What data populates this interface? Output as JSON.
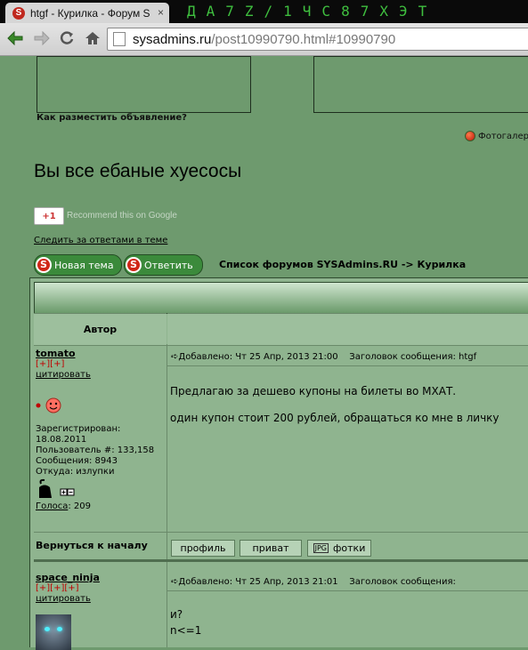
{
  "browser": {
    "tab_title": "htgf - Курилка - Форум S",
    "tab_icon": "S",
    "close_glyph": "×",
    "titlebar_glyphs": "ДА7Z/1ЧС87ХЭТ",
    "url_host": "sysadmins.ru",
    "url_path": "/post10990790.html#10990790"
  },
  "header": {
    "ad_link": "Как разместить объявление?",
    "photo_link": "Фотогалер"
  },
  "topic": {
    "title": "Вы все ебаные хуесосы",
    "gplus_label": "+1",
    "gplus_recommend": "Recommend this on Google",
    "watch_replies": "Следить за ответами в теме",
    "new_topic_button": "Новая тема",
    "reply_button": "Ответить",
    "breadcrumb": "Список форумов SYSAdmins.RU -> Курилка"
  },
  "table": {
    "author_header": "Автор"
  },
  "posts": [
    {
      "nick": "tomato",
      "rank": "[+][+]",
      "quote": "цитировать",
      "registered_label": "Зарегистрирован:",
      "registered_date": "18.08.2011",
      "user_number": "Пользователь #: 133,158",
      "messages": "Сообщения: 8943",
      "from": "Откуда: излупки",
      "votes_label": "Голоса",
      "votes_value": ": 209",
      "posted": "Добавлено: Чт 25 Апр, 2013 21:00",
      "subject": "Заголовок сообщения: htgf",
      "body_line1": "Предлагаю за дешево купоны на билеты во МХАТ.",
      "body_line2": "один купон стоит 200 рублей, обращаться ко мне в личку",
      "back_to_top": "Вернуться к началу",
      "profile_button": "профиль",
      "private_button": "приват",
      "photos_button": "фотки"
    },
    {
      "nick": "space_ninja",
      "rank": "[+][+][+]",
      "quote": "цитировать",
      "posted": "Добавлено: Чт 25 Апр, 2013 21:01",
      "subject": "Заголовок сообщения:",
      "body_line1": "и?",
      "body_line2": "n<=1"
    }
  ],
  "colors": {
    "page_bg": "#6e9a6e",
    "forum_bg": "#8fb48f",
    "rank_red": "#c00000",
    "button_green": "#3b8a3b"
  }
}
